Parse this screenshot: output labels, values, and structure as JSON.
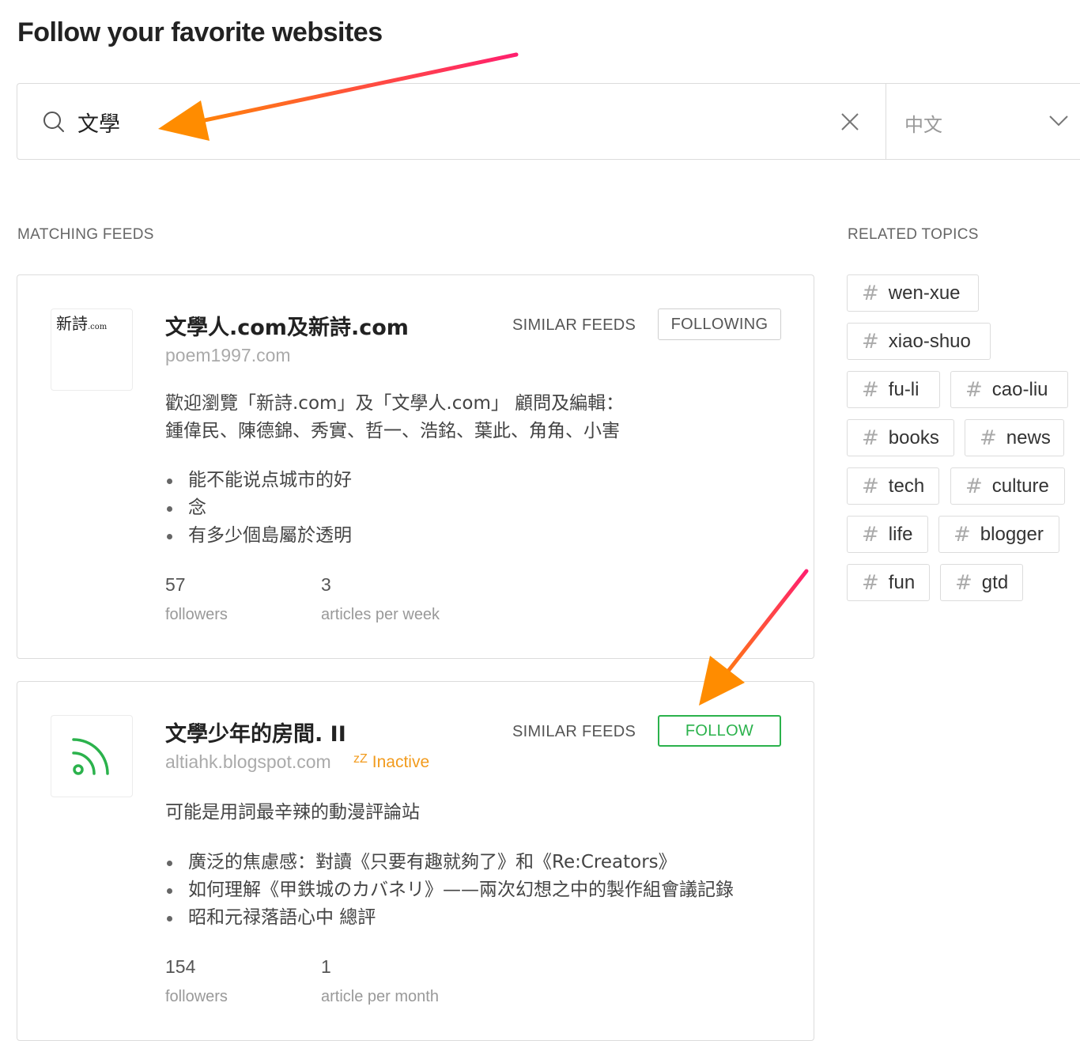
{
  "page": {
    "title": "Follow your favorite websites"
  },
  "search": {
    "query": "文學",
    "language": "中文"
  },
  "sections": {
    "matching": "MATCHING FEEDS",
    "related": "RELATED TOPICS"
  },
  "feeds": [
    {
      "title": "文學人.com及新詩.com",
      "url": "poem1997.com",
      "similar_label": "SIMILAR FEEDS",
      "follow_label": "FOLLOWING",
      "logo_text": "新詩",
      "logo_suffix": ".com",
      "desc_lines": [
        "歡迎瀏覽「新詩.com」及「文學人.com」 顧問及編輯：",
        "鍾偉民、陳德錦、秀實、哲一、浩銘、葉此、角角、小害"
      ],
      "articles": [
        "能不能说点城市的好",
        "念",
        "有多少個島屬於透明"
      ],
      "followers": "57",
      "followers_label": "followers",
      "frequency": "3",
      "frequency_label": "articles per week"
    },
    {
      "title": "文學少年的房間. II",
      "url": "altiahk.blogspot.com",
      "status_zz": "zZ",
      "status": "Inactive",
      "similar_label": "SIMILAR FEEDS",
      "follow_label": "FOLLOW",
      "logo_icon": "rss-icon",
      "desc_lines": [
        "可能是用詞最辛辣的動漫評論站"
      ],
      "articles": [
        "廣泛的焦慮感：對讀《只要有趣就夠了》和《Re:Creators》",
        "如何理解《甲鉄城のカバネリ》——兩次幻想之中的製作組會議記錄",
        "昭和元禄落語心中 總評"
      ],
      "followers": "154",
      "followers_label": "followers",
      "frequency": "1",
      "frequency_label": "article per month"
    }
  ],
  "topics": [
    "wen-xue",
    "xiao-shuo",
    "fu-li",
    "cao-liu",
    "books",
    "news",
    "tech",
    "culture",
    "life",
    "blogger",
    "fun",
    "gtd"
  ],
  "colors": {
    "green": "#2bb24c",
    "inactive": "#f29b1d",
    "border": "#dcdcdc",
    "arrow_start": "#ff8c00",
    "arrow_end": "#ff1f6e"
  }
}
